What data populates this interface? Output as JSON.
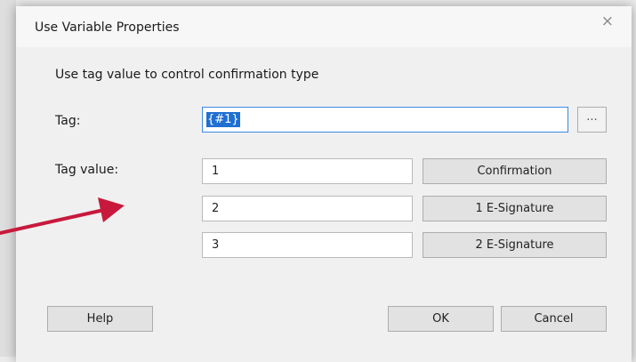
{
  "dialog": {
    "title": "Use Variable Properties",
    "close_glyph": "×",
    "description": "Use tag value to control confirmation type",
    "tag_label": "Tag:",
    "tag_value": "{#1}",
    "browse_label": "...",
    "tag_value_label": "Tag value:",
    "rows": [
      {
        "value": "1",
        "button": "Confirmation"
      },
      {
        "value": "2",
        "button": "1 E-Signature"
      },
      {
        "value": "3",
        "button": "2 E-Signature"
      }
    ],
    "help_label": "Help",
    "ok_label": "OK",
    "cancel_label": "Cancel"
  },
  "colors": {
    "accent": "#1f6fd1",
    "annotation_arrow": "#c8193c"
  },
  "icons": [
    "close-icon",
    "annotation-arrow"
  ]
}
